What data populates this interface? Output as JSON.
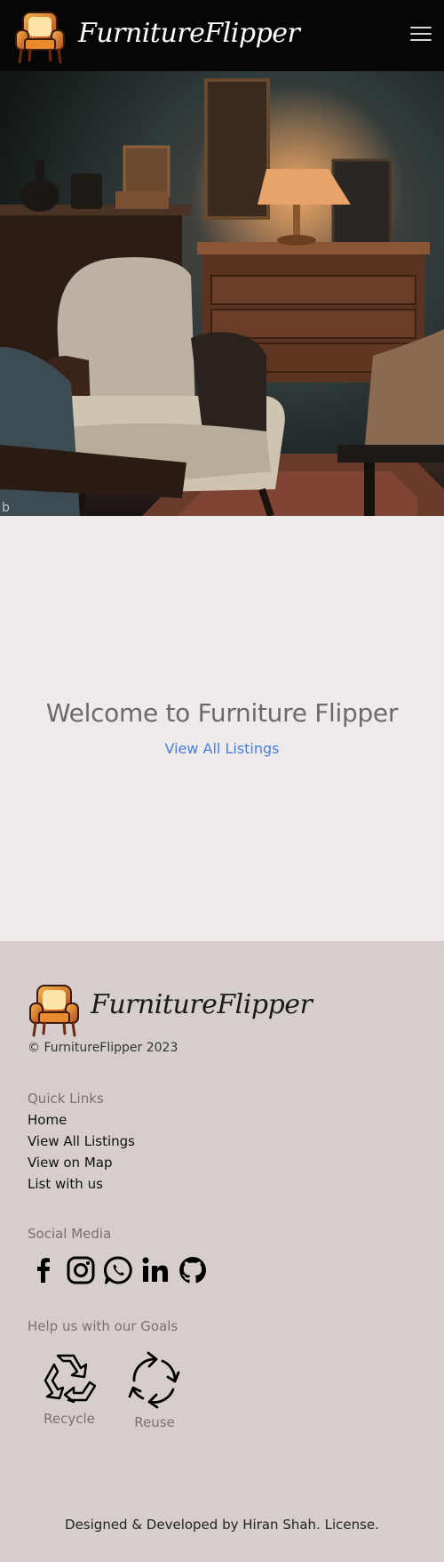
{
  "navbar": {
    "brand_name": "FurnitureFlipper",
    "logo_icon": "armchair-icon",
    "menu_icon": "hamburger-menu-icon"
  },
  "hero": {
    "image_description_icon": "vintage-furniture-room-photo"
  },
  "welcome": {
    "title": "Welcome to Furniture Flipper",
    "link_label": "View All Listings",
    "link_color": "#4a7ede"
  },
  "footer": {
    "brand_name": "FurnitureFlipper",
    "copyright": "© FurnitureFlipper 2023",
    "quick_links_heading": "Quick Links",
    "quick_links": [
      "Home",
      "View All Listings",
      "View on Map",
      "List with us"
    ],
    "social_heading": "Social Media",
    "social_icons": [
      "facebook-icon",
      "instagram-icon",
      "whatsapp-icon",
      "linkedin-icon",
      "github-icon"
    ],
    "goals_heading": "Help us with our Goals",
    "goals": [
      {
        "label": "Recycle",
        "icon": "recycle-icon"
      },
      {
        "label": "Reuse",
        "icon": "reuse-icon"
      }
    ],
    "credits_prefix": "Designed & Developed by ",
    "credits_author": "Hiran Shah",
    "credits_license": "License"
  },
  "colors": {
    "navbar_bg": "#060606",
    "page_bg": "#efebea",
    "footer_bg": "#d6cecd",
    "muted_text": "#7a7272"
  }
}
